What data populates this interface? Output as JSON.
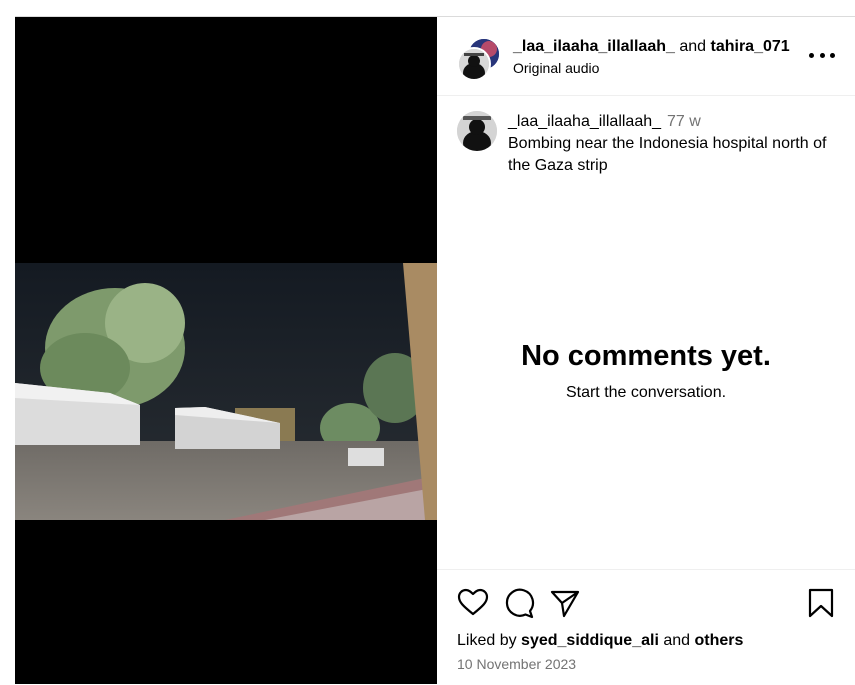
{
  "post": {
    "owner_user": "_laa_ilaaha_illallaah_",
    "connector": "and",
    "collab_user": "tahira_071",
    "audio_label": "Original audio"
  },
  "caption": {
    "username": "_laa_ilaaha_illallaah_",
    "time_ago": "77 w",
    "text": "Bombing near the Indonesia hospital north of the Gaza strip"
  },
  "comments": {
    "empty_title": "No comments yet.",
    "empty_subtitle": "Start the conversation."
  },
  "footer": {
    "liked_by_prefix": "Liked by",
    "liked_by_user": "syed_siddique_ali",
    "liked_by_connector": "and",
    "liked_by_others": "others",
    "date": "10 November 2023"
  },
  "icons": {
    "like": "heart-icon",
    "comment": "comment-icon",
    "share": "share-icon",
    "save": "bookmark-icon",
    "more": "more-options-icon"
  }
}
